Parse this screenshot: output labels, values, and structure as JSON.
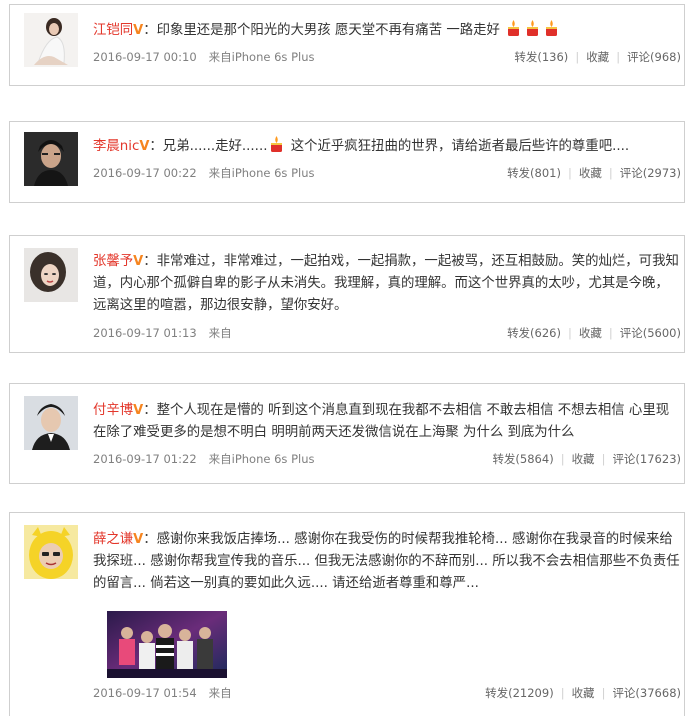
{
  "comments": [
    {
      "username": "江铠同",
      "verified_badge": "V",
      "text": "：印象里还是那个阳光的大男孩  愿天堂不再有痛苦  一路走好",
      "text_suffix": "",
      "candle_icons": 3,
      "time": "2016-09-17 00:10",
      "source": "来自iPhone 6s Plus",
      "repost": "转发(136)",
      "favorite": "收藏",
      "comment": "评论(968)"
    },
    {
      "username": "李晨nic",
      "verified_badge": "V",
      "text": "：兄弟......走好......",
      "text_suffix": " 这个近乎疯狂扭曲的世界，请给逝者最后些许的尊重吧....",
      "candle_icons": 1,
      "time": "2016-09-17 00:22",
      "source": "来自iPhone 6s Plus",
      "repost": "转发(801)",
      "favorite": "收藏",
      "comment": "评论(2973)"
    },
    {
      "username": "张馨予",
      "verified_badge": "V",
      "text": "：非常难过，非常难过，一起拍戏，一起捐款，一起被骂，还互相鼓励。笑的灿烂，可我知道，内心那个孤僻自卑的影子从未消失。我理解，真的理解。而这个世界真的太吵，尤其是今晚，远离这里的喧嚣，那边很安静，望你安好。",
      "text_suffix": "",
      "candle_icons": 0,
      "time": "2016-09-17 01:13",
      "source": "来自",
      "repost": "转发(626)",
      "favorite": "收藏",
      "comment": "评论(5600)"
    },
    {
      "username": "付辛博",
      "verified_badge": "V",
      "text": "：整个人现在是懵的  听到这个消息直到现在我都不去相信  不敢去相信  不想去相信  心里现在除了难受更多的是想不明白  明明前两天还发微信说在上海聚  为什么  到底为什么",
      "text_suffix": "",
      "candle_icons": 0,
      "time": "2016-09-17 01:22",
      "source": "来自iPhone 6s Plus",
      "repost": "转发(5864)",
      "favorite": "收藏",
      "comment": "评论(17623)"
    },
    {
      "username": "薛之谦",
      "verified_badge": "V",
      "text": "：感谢你来我饭店捧场... 感谢你在我受伤的时候帮我推轮椅... 感谢你在我录音的时候来给我探班... 感谢你帮我宣传我的音乐... 但我无法感谢你的不辞而别... 所以我不会去相信那些不负责任的留言... 倘若这一别真的要如此久远.... 请还给逝者尊重和尊严...",
      "text_suffix": "",
      "candle_icons": 0,
      "time": "2016-09-17 01:54",
      "source": "来自",
      "repost": "转发(21209)",
      "favorite": "收藏",
      "comment": "评论(37668)"
    }
  ]
}
